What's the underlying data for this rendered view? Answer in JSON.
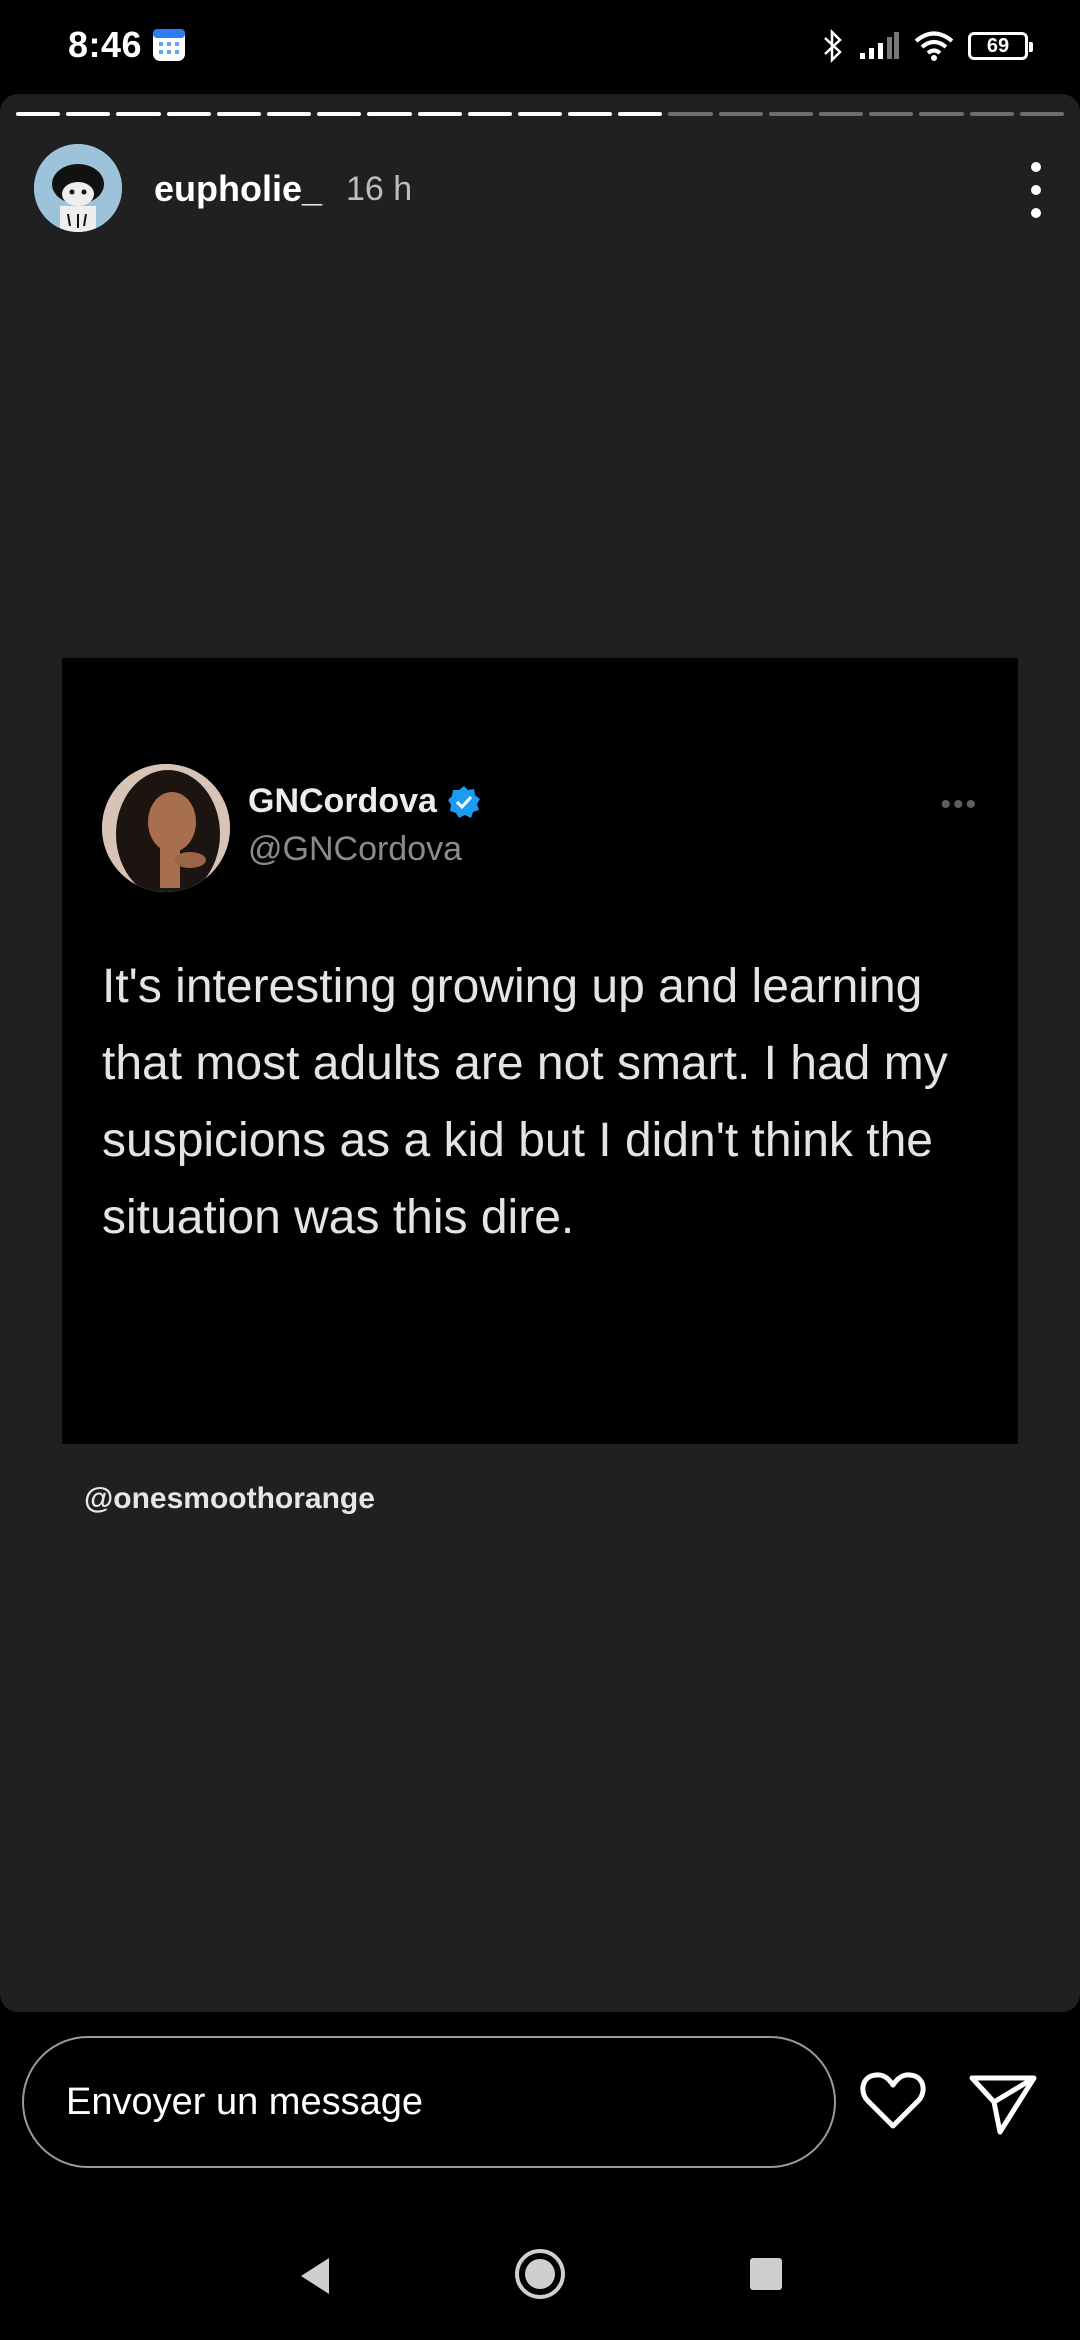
{
  "status_bar": {
    "time": "8:46",
    "battery": "69",
    "icons": [
      "calendar-icon",
      "bluetooth-icon",
      "signal-icon",
      "wifi-icon",
      "battery-icon"
    ]
  },
  "story": {
    "username": "eupholie_",
    "time_ago": "16 h",
    "progress": {
      "total_segments": 21,
      "completed_segments": 13
    }
  },
  "tweet": {
    "name": "GNCordova",
    "handle": "@GNCordova",
    "text": "It's interesting growing up and learning that most adults are not smart. I had my suspicions as a kid but I didn't think the situation was this dire.",
    "verified_color": "#1d9bf0"
  },
  "credit": "@onesmoothorange",
  "reply": {
    "placeholder": "Envoyer un message",
    "icons": [
      "heart-icon",
      "send-icon"
    ]
  },
  "navbar": {
    "icons": [
      "back-icon",
      "home-icon",
      "recents-icon"
    ]
  }
}
